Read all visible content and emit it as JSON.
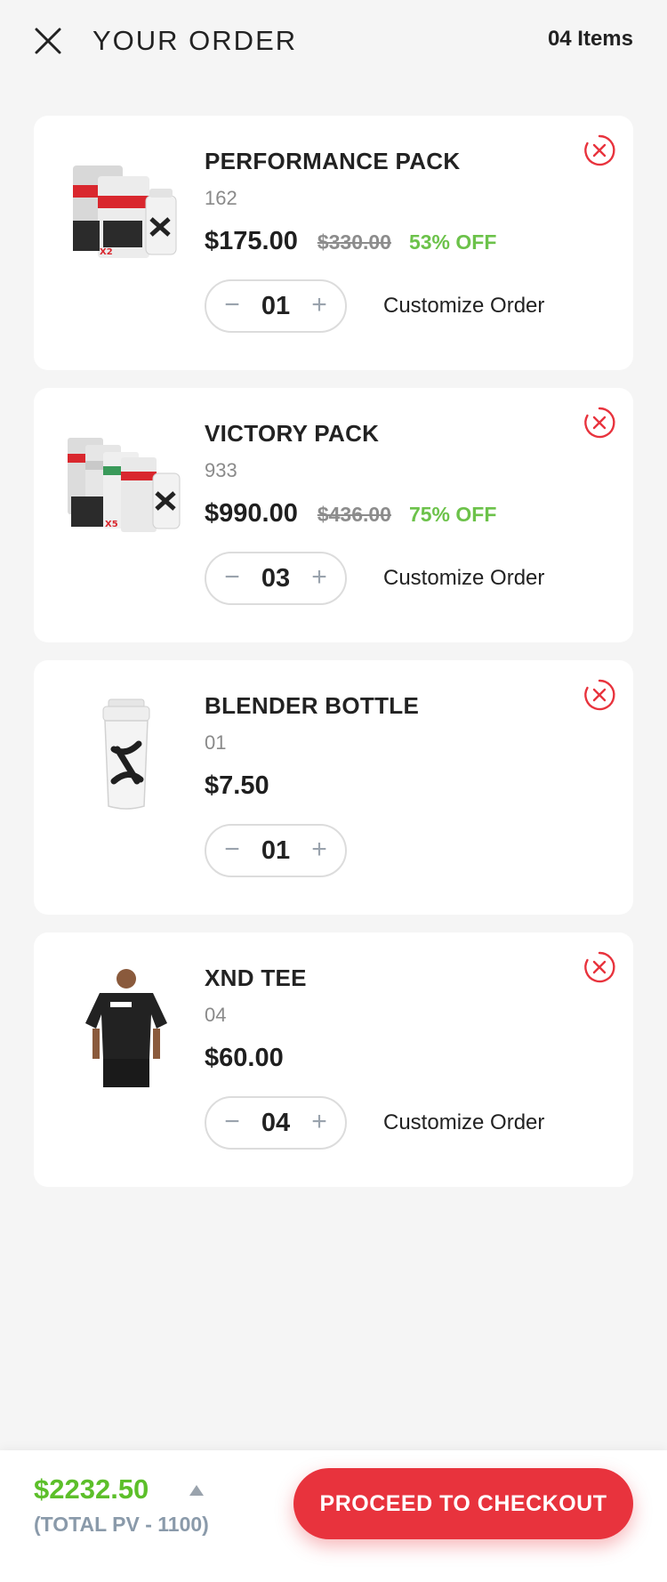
{
  "header": {
    "title": "YOUR ORDER",
    "item_count": "04 Items",
    "close_icon": "close-icon"
  },
  "items": [
    {
      "name": "PERFORMANCE PACK",
      "code": "162",
      "price": "$175.00",
      "old_price": "$330.00",
      "discount": "53% OFF",
      "qty": "01",
      "customize": "Customize Order",
      "image": "performance-pack-product-image"
    },
    {
      "name": "VICTORY PACK",
      "code": "933",
      "price": "$990.00",
      "old_price": "$436.00",
      "discount": "75% OFF",
      "qty": "03",
      "customize": "Customize Order",
      "image": "victory-pack-product-image"
    },
    {
      "name": "BLENDER BOTTLE",
      "code": "01",
      "price": "$7.50",
      "old_price": "",
      "discount": "",
      "qty": "01",
      "customize": "",
      "image": "blender-bottle-product-image"
    },
    {
      "name": "XND TEE",
      "code": "04",
      "price": "$60.00",
      "old_price": "",
      "discount": "",
      "qty": "04",
      "customize": "Customize Order",
      "image": "xnd-tee-product-image"
    }
  ],
  "stepper": {
    "minus": "−",
    "plus": "+"
  },
  "footer": {
    "total": "$2232.50",
    "pv": "(TOTAL PV - 1100)",
    "checkout_label": "PROCEED TO CHECKOUT"
  },
  "colors": {
    "accent_red": "#e8333d",
    "discount_green": "#6cc24a",
    "total_green": "#5cbf2a",
    "background": "#f5f5f5"
  }
}
